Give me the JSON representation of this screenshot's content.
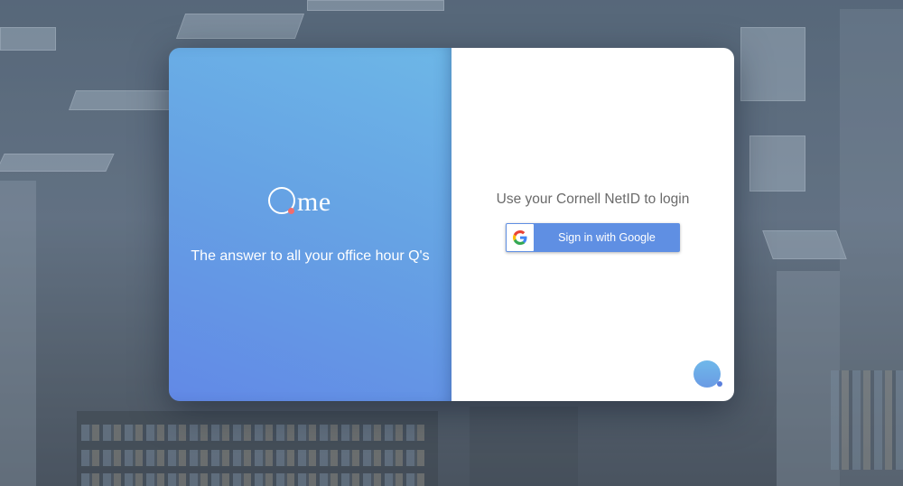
{
  "brand": {
    "logo_text": "me",
    "logo_icon": "q-ring-icon",
    "tagline": "The answer to all your office hour Q's"
  },
  "login": {
    "prompt": "Use your Cornell NetID to login",
    "google_button_label": "Sign in with Google",
    "google_icon": "google-g-icon"
  },
  "colors": {
    "panel_gradient_start": "#6289e6",
    "panel_gradient_end": "#6db7e7",
    "google_button": "#5f8fe3",
    "logo_dot": "#f26d6d"
  }
}
